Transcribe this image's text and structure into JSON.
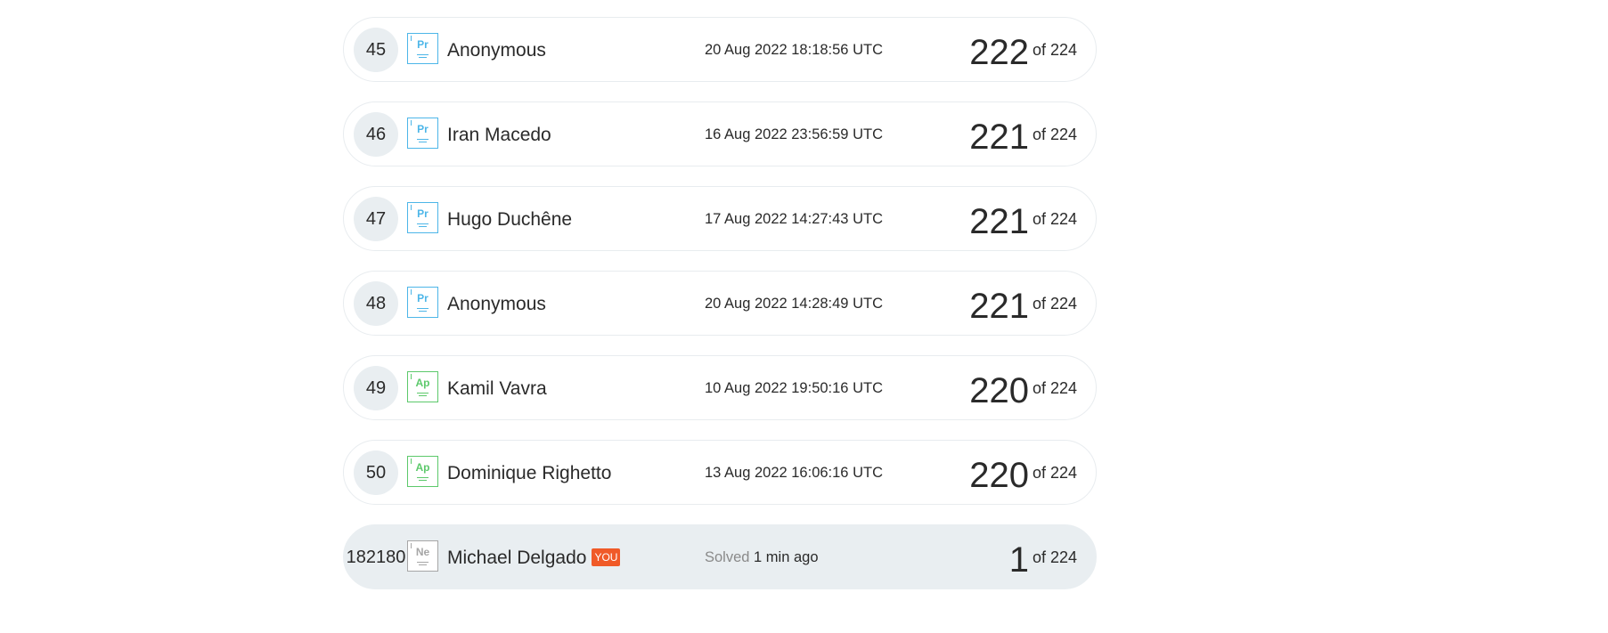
{
  "colors": {
    "pr_badge": "#4db6e8",
    "ap_badge": "#5cc96b",
    "ne_badge": "#a6a6a6",
    "you_tag": "#f05a28",
    "highlight_row": "#e9eef1"
  },
  "rows": [
    {
      "rank": "45",
      "badge": "Pr",
      "name": "Anonymous",
      "date": "20 Aug 2022 18:18:56 UTC",
      "score": "222",
      "of": "of 224"
    },
    {
      "rank": "46",
      "badge": "Pr",
      "name": "Iran Macedo",
      "date": "16 Aug 2022 23:56:59 UTC",
      "score": "221",
      "of": "of 224"
    },
    {
      "rank": "47",
      "badge": "Pr",
      "name": "Hugo Duchêne",
      "date": "17 Aug 2022 14:27:43 UTC",
      "score": "221",
      "of": "of 224"
    },
    {
      "rank": "48",
      "badge": "Pr",
      "name": "Anonymous",
      "date": "20 Aug 2022 14:28:49 UTC",
      "score": "221",
      "of": "of 224"
    },
    {
      "rank": "49",
      "badge": "Ap",
      "name": "Kamil Vavra",
      "date": "10 Aug 2022 19:50:16 UTC",
      "score": "220",
      "of": "of 224"
    },
    {
      "rank": "50",
      "badge": "Ap",
      "name": "Dominique Righetto",
      "date": "13 Aug 2022 16:06:16 UTC",
      "score": "220",
      "of": "of 224"
    }
  ],
  "you_row": {
    "rank": "182180",
    "badge": "Ne",
    "name": "Michael Delgado",
    "you_tag": "YOU",
    "solved_label": "Solved",
    "solved_time": "1 min ago",
    "score": "1",
    "of": "of 224"
  }
}
